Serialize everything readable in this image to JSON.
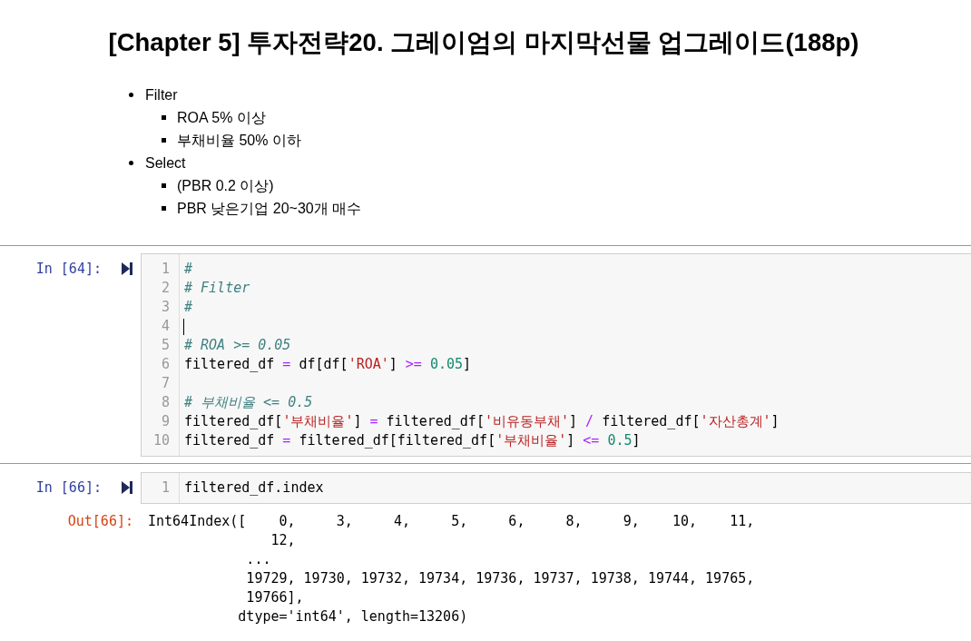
{
  "markdown": {
    "title": "[Chapter 5] 투자전략20. 그레이엄의 마지막선물 업그레이드(188p)",
    "list": [
      {
        "text": "Filter",
        "children": [
          {
            "text": "ROA 5% 이상"
          },
          {
            "text": "부채비율 50% 이하"
          }
        ]
      },
      {
        "text": "Select",
        "children": [
          {
            "text": "(PBR 0.2 이상)"
          },
          {
            "text": "PBR 낮은기업 20~30개 매수"
          }
        ]
      }
    ]
  },
  "cells": [
    {
      "prompt": "In [64]:",
      "lines": [
        {
          "number": "1",
          "cursor": false,
          "tokens": [
            {
              "kind": "comment",
              "text": "#"
            }
          ]
        },
        {
          "number": "2",
          "cursor": false,
          "tokens": [
            {
              "kind": "comment",
              "text": "# Filter"
            }
          ]
        },
        {
          "number": "3",
          "cursor": false,
          "tokens": [
            {
              "kind": "comment",
              "text": "#"
            }
          ]
        },
        {
          "number": "4",
          "cursor": true
        },
        {
          "number": "5",
          "cursor": false,
          "tokens": [
            {
              "kind": "comment",
              "text": "# ROA >= 0.05"
            }
          ]
        },
        {
          "number": "6",
          "cursor": false,
          "tokens": [
            {
              "kind": "plain",
              "text": "filtered_df"
            },
            {
              "kind": "operator",
              "text": " = "
            },
            {
              "kind": "plain",
              "text": "df[df["
            },
            {
              "kind": "string",
              "text": "'ROA'"
            },
            {
              "kind": "plain",
              "text": "]"
            },
            {
              "kind": "operator",
              "text": " >= "
            },
            {
              "kind": "number",
              "text": "0.05"
            },
            {
              "kind": "plain",
              "text": "]"
            }
          ]
        },
        {
          "number": "7",
          "cursor": false
        },
        {
          "number": "8",
          "cursor": false,
          "tokens": [
            {
              "kind": "comment",
              "text": "# 부채비율 <= 0.5"
            }
          ]
        },
        {
          "number": "9",
          "cursor": false,
          "tokens": [
            {
              "kind": "plain",
              "text": "filtered_df["
            },
            {
              "kind": "string",
              "text": "'부채비율'"
            },
            {
              "kind": "plain",
              "text": "]"
            },
            {
              "kind": "operator",
              "text": " = "
            },
            {
              "kind": "plain",
              "text": "filtered_df["
            },
            {
              "kind": "string",
              "text": "'비유동부채'"
            },
            {
              "kind": "plain",
              "text": "]"
            },
            {
              "kind": "operator",
              "text": " / "
            },
            {
              "kind": "plain",
              "text": "filtered_df["
            },
            {
              "kind": "string",
              "text": "'자산총계'"
            },
            {
              "kind": "plain",
              "text": "]"
            }
          ]
        },
        {
          "number": "10",
          "cursor": false,
          "tokens": [
            {
              "kind": "plain",
              "text": "filtered_df"
            },
            {
              "kind": "operator",
              "text": " = "
            },
            {
              "kind": "plain",
              "text": "filtered_df[filtered_df["
            },
            {
              "kind": "string",
              "text": "'부채비율'"
            },
            {
              "kind": "plain",
              "text": "]"
            },
            {
              "kind": "operator",
              "text": " <= "
            },
            {
              "kind": "number",
              "text": "0.5"
            },
            {
              "kind": "plain",
              "text": "]"
            }
          ]
        }
      ]
    },
    {
      "prompt": "In [66]:",
      "lines": [
        {
          "number": "1",
          "cursor": false,
          "tokens": [
            {
              "kind": "plain",
              "text": "filtered_df.index"
            }
          ]
        }
      ],
      "output": {
        "prompt": "Out[66]:",
        "text": "Int64Index([    0,     3,     4,     5,     6,     8,     9,    10,    11,\n               12,\n            ...\n            19729, 19730, 19732, 19734, 19736, 19737, 19738, 19744, 19765,\n            19766],\n           dtype='int64', length=13206)"
      }
    }
  ]
}
